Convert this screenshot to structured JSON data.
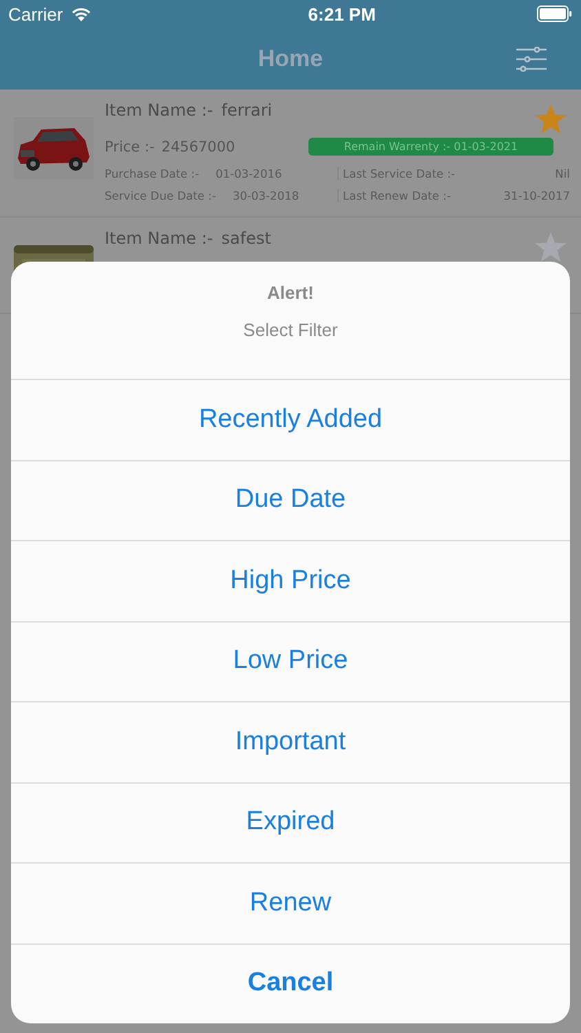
{
  "status_bar": {
    "carrier": "Carrier",
    "time": "6:21 PM"
  },
  "nav": {
    "title": "Home"
  },
  "items": [
    {
      "name_label": "Item Name  :-",
      "name": "ferrari",
      "important": true,
      "price_label": "Price  :-",
      "price": "24567000",
      "warranty": "Remain Warrenty  :-  01-03-2021",
      "details": [
        {
          "label": "Purchase Date  :-",
          "value": "01-03-2016"
        },
        {
          "label": "Last Service Date  :-",
          "value": "Nil"
        },
        {
          "label": "Service Due Date  :-",
          "value": "30-03-2018"
        },
        {
          "label": "Last Renew Date  :-",
          "value": "31-10-2017"
        }
      ]
    },
    {
      "name_label": "Item Name  :-",
      "name": "safest",
      "important": false
    }
  ],
  "alert": {
    "title": "Alert!",
    "message": "Select Filter",
    "actions": [
      {
        "label": "Recently Added",
        "kind": "default"
      },
      {
        "label": "Due Date",
        "kind": "default"
      },
      {
        "label": "High Price",
        "kind": "default"
      },
      {
        "label": "Low Price",
        "kind": "default"
      },
      {
        "label": "Important",
        "kind": "default"
      },
      {
        "label": "Expired",
        "kind": "default"
      },
      {
        "label": "Renew",
        "kind": "default"
      },
      {
        "label": "Cancel",
        "kind": "cancel"
      }
    ]
  }
}
